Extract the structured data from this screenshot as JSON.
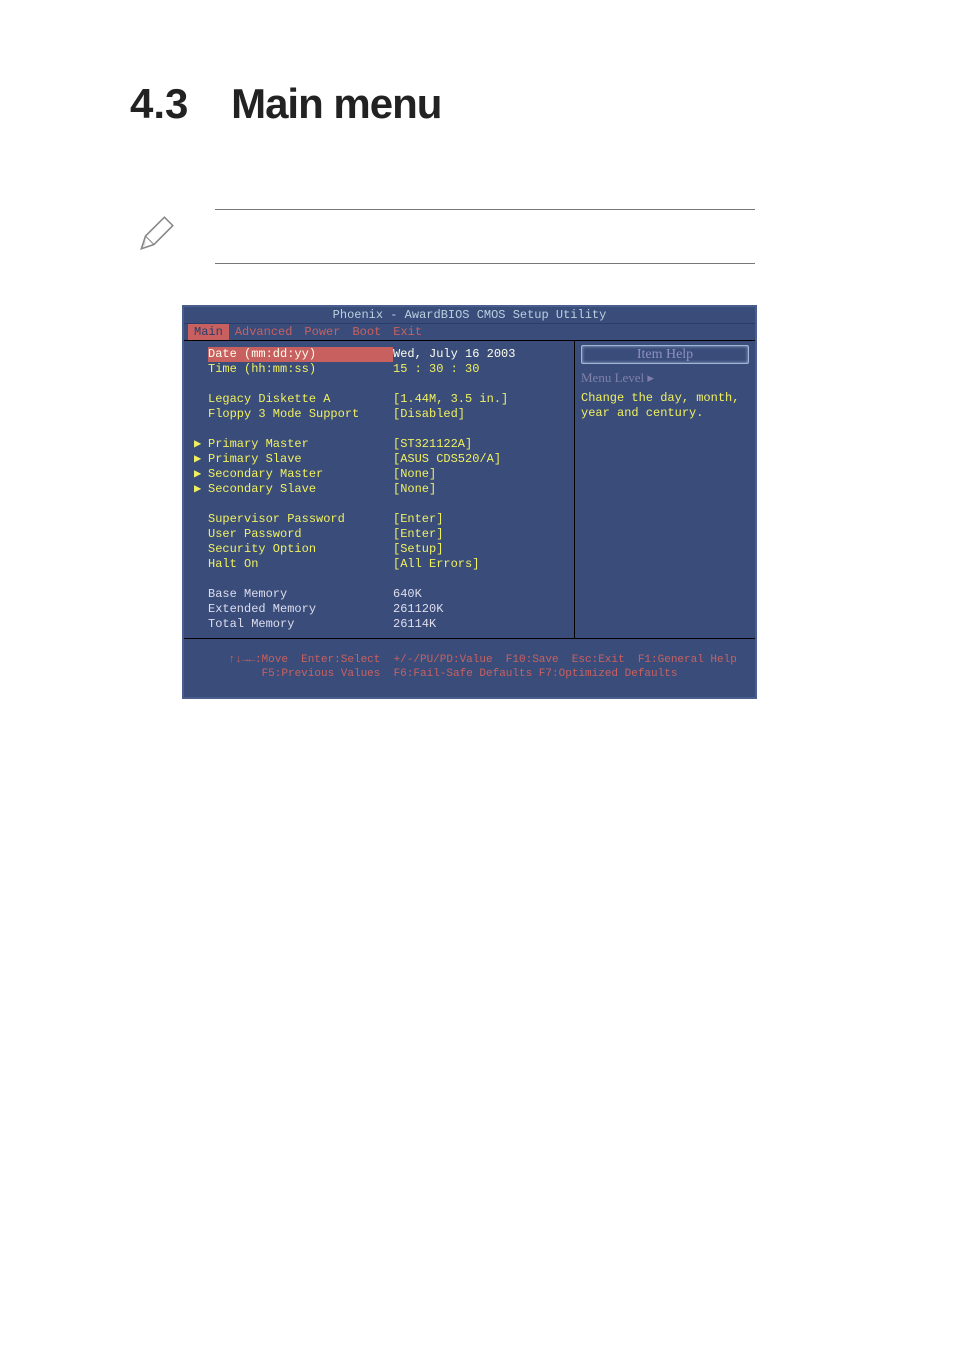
{
  "heading": {
    "num": "4.3",
    "title": "Main menu"
  },
  "bios": {
    "title": "Phoenix - AwardBIOS CMOS Setup Utility",
    "tabs": [
      "Main",
      "Advanced",
      "Power",
      "Boot",
      "Exit"
    ],
    "active_tab": "Main",
    "items": [
      {
        "arrow": "",
        "label": "Date (mm:dd:yy)",
        "value": "Wed, July 16 2003",
        "highlight": true,
        "white": false
      },
      {
        "arrow": "",
        "label": "Time (hh:mm:ss)",
        "value": "15 : 30 : 30",
        "white": false
      },
      {
        "blank": true
      },
      {
        "arrow": "",
        "label": "Legacy Diskette A",
        "value": "[1.44M, 3.5 in.]",
        "white": false
      },
      {
        "arrow": "",
        "label": "Floppy 3 Mode Support",
        "value": "[Disabled]",
        "white": false
      },
      {
        "blank": true
      },
      {
        "arrow": "▶",
        "label": "Primary Master",
        "value": "[ST321122A]",
        "white": false
      },
      {
        "arrow": "▶",
        "label": "Primary Slave",
        "value": "[ASUS CDS520/A]",
        "white": false
      },
      {
        "arrow": "▶",
        "label": "Secondary Master",
        "value": "[None]",
        "white": false
      },
      {
        "arrow": "▶",
        "label": "Secondary Slave",
        "value": "[None]",
        "white": false
      },
      {
        "blank": true
      },
      {
        "arrow": "",
        "label": "Supervisor Password",
        "value": "[Enter]",
        "white": false
      },
      {
        "arrow": "",
        "label": "User Password",
        "value": "[Enter]",
        "white": false
      },
      {
        "arrow": "",
        "label": "Security Option",
        "value": "[Setup]",
        "white": false
      },
      {
        "arrow": "",
        "label": "Halt On",
        "value": "[All Errors]",
        "white": false
      },
      {
        "blank": true
      },
      {
        "arrow": "",
        "label": "Base Memory",
        "value": "640K",
        "white": true
      },
      {
        "arrow": "",
        "label": "Extended Memory",
        "value": "261120K",
        "white": true
      },
      {
        "arrow": "",
        "label": "Total Memory",
        "value": "26114K",
        "white": true
      }
    ],
    "help": {
      "title": "Item Help",
      "level": "Menu Level   ▸",
      "text": "Change the day, month, year and century."
    },
    "footer": {
      "line1": "↑↓→←:Move  Enter:Select  +/-/PU/PD:Value  F10:Save  Esc:Exit  F1:General Help",
      "line2": "F5:Previous Values  F6:Fail-Safe Defaults F7:Optimized Defaults"
    }
  }
}
